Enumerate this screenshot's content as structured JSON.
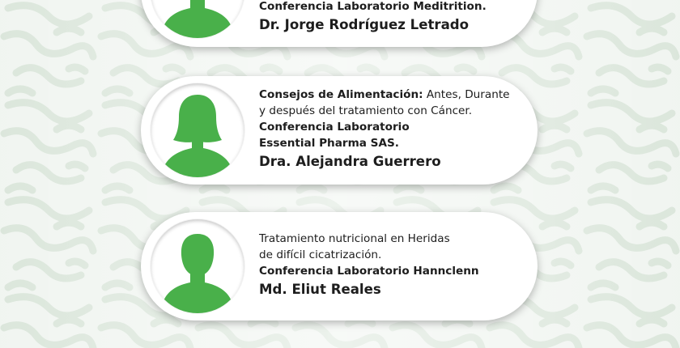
{
  "colors": {
    "accent_green": "#49b04a",
    "card_bg": "#ffffff",
    "text": "#1d1d1d",
    "pattern": "#d7e3d7"
  },
  "speakers": [
    {
      "avatar_icon": "male-silhouette-icon",
      "lines": [
        "Conferencia Laboratorio Meditrition."
      ],
      "name": "Dr. Jorge Rodríguez Letrado"
    },
    {
      "avatar_icon": "female-silhouette-icon",
      "topic_bold": "Consejos de Alimentación:",
      "topic_rest": " Antes, Durante",
      "line2": "y después del tratamiento con Cáncer.",
      "lab_line1": "Conferencia Laboratorio",
      "lab_line2": "Essential Pharma SAS.",
      "name": "Dra. Alejandra Guerrero"
    },
    {
      "avatar_icon": "male-silhouette-icon",
      "line1": "Tratamiento nutricional en Heridas",
      "line2": "de difícil cicatrización.",
      "lab_line": "Conferencia Laboratorio Hannclenn",
      "name": "Md. Eliut Reales"
    }
  ]
}
